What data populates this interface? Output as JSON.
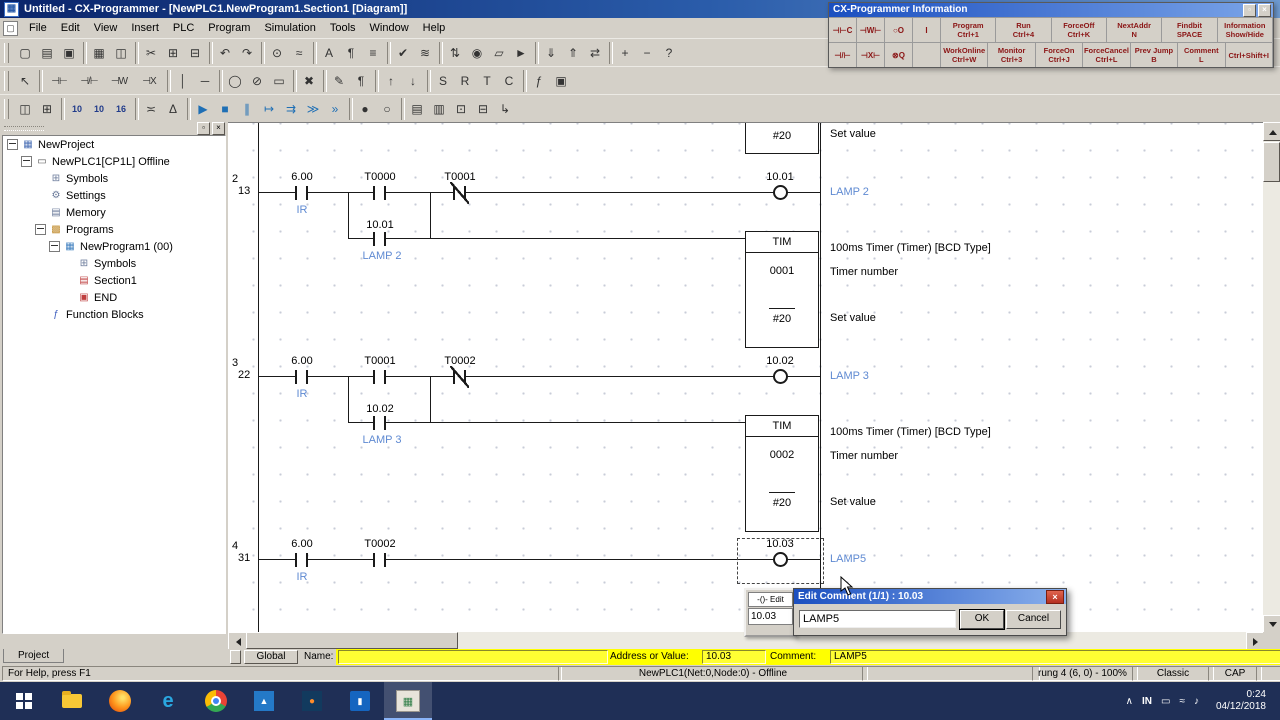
{
  "titlebar": {
    "title": "Untitled - CX-Programmer - [NewPLC1.NewProgram1.Section1 [Diagram]]"
  },
  "menubar": {
    "items": [
      "File",
      "Edit",
      "View",
      "Insert",
      "PLC",
      "Program",
      "Simulation",
      "Tools",
      "Window",
      "Help"
    ]
  },
  "icons": {
    "app": "▦",
    "doc": "▢",
    "close": "×",
    "dock": "▫",
    "project": "▦",
    "plc": "▭",
    "symbols": "⊞",
    "settings": "⚙",
    "memory": "▤",
    "programs": "▩",
    "program": "▦",
    "section": "▤",
    "end": "▣",
    "fb": "ƒ",
    "edge": "e",
    "photos": "▲",
    "media": "●",
    "bluestripe": "▮",
    "cx": "▦",
    "display": "▭",
    "network": "≈",
    "volume": "♪"
  },
  "toolbar1": {
    "icons": [
      {
        "n": "new-icon",
        "g": "▢"
      },
      {
        "n": "open-icon",
        "g": "▤"
      },
      {
        "n": "save-icon",
        "g": "▣"
      },
      {
        "n": "toolbar-separator",
        "c": "sep"
      },
      {
        "n": "print-icon",
        "g": "▦"
      },
      {
        "n": "print-preview-icon",
        "g": "◫"
      },
      {
        "n": "toolbar-separator",
        "c": "sep"
      },
      {
        "n": "cut-icon",
        "g": "✂"
      },
      {
        "n": "copy-icon",
        "g": "⊞"
      },
      {
        "n": "paste-icon",
        "g": "⊟"
      },
      {
        "n": "toolbar-separator",
        "c": "sep"
      },
      {
        "n": "undo-icon",
        "g": "↶"
      },
      {
        "n": "redo-icon",
        "g": "↷"
      },
      {
        "n": "toolbar-separator",
        "c": "sep"
      },
      {
        "n": "find-icon",
        "g": "⊙"
      },
      {
        "n": "replace-icon",
        "g": "≈"
      },
      {
        "n": "toolbar-separator",
        "c": "sep"
      },
      {
        "n": "symbol-table-icon",
        "g": "A"
      },
      {
        "n": "io-comment-icon",
        "g": "¶"
      },
      {
        "n": "section-list-icon",
        "g": "≡"
      },
      {
        "n": "toolbar-separator",
        "c": "sep"
      },
      {
        "n": "compile-icon",
        "g": "✔"
      },
      {
        "n": "compile-all-icon",
        "g": "≋"
      },
      {
        "n": "toolbar-separator",
        "c": "sep"
      },
      {
        "n": "work-online-icon",
        "g": "⇅"
      },
      {
        "n": "monitor-mode-icon",
        "g": "◉"
      },
      {
        "n": "program-mode-icon",
        "g": "▱"
      },
      {
        "n": "run-mode-icon",
        "g": "►"
      },
      {
        "n": "toolbar-separator",
        "c": "sep"
      },
      {
        "n": "transfer-to-plc-icon",
        "g": "⇓"
      },
      {
        "n": "transfer-from-plc-icon",
        "g": "⇑"
      },
      {
        "n": "compare-with-plc-icon",
        "g": "⇄"
      },
      {
        "n": "toolbar-separator",
        "c": "sep"
      },
      {
        "n": "zoom-in-icon",
        "g": "+"
      },
      {
        "n": "zoom-out-icon",
        "g": "−"
      },
      {
        "n": "help-icon",
        "g": "?"
      }
    ]
  },
  "toolbar2": {
    "icons": [
      {
        "n": "selection-arrow-icon",
        "g": "↖"
      },
      {
        "n": "toolbar-separator",
        "c": "sep"
      },
      {
        "n": "new-contact-icon",
        "g": "⊣⊢",
        "c": "wide"
      },
      {
        "n": "new-closed-contact-icon",
        "g": "⊣/⊢",
        "c": "wide"
      },
      {
        "n": "new-or-contact-icon",
        "g": "⊣W",
        "c": "wide"
      },
      {
        "n": "new-closed-or-contact-icon",
        "g": "⊣X",
        "c": "wide"
      },
      {
        "n": "toolbar-separator",
        "c": "sep"
      },
      {
        "n": "vertical-line-icon",
        "g": "│"
      },
      {
        "n": "horizontal-line-icon",
        "g": "─"
      },
      {
        "n": "toolbar-separator",
        "c": "sep"
      },
      {
        "n": "new-coil-icon",
        "g": "◯"
      },
      {
        "n": "new-closed-coil-icon",
        "g": "⊘"
      },
      {
        "n": "new-instruction-icon",
        "g": "▭"
      },
      {
        "n": "toolbar-separator",
        "c": "sep"
      },
      {
        "n": "delete-icon",
        "g": "✖"
      },
      {
        "n": "toolbar-separator",
        "c": "sep"
      },
      {
        "n": "edit-comment-icon",
        "g": "✎"
      },
      {
        "n": "rung-comment-icon",
        "g": "¶"
      },
      {
        "n": "toolbar-separator",
        "c": "sep"
      },
      {
        "n": "differential-up-icon",
        "g": "↑"
      },
      {
        "n": "differential-down-icon",
        "g": "↓"
      },
      {
        "n": "toolbar-separator",
        "c": "sep"
      },
      {
        "n": "set-instruction-icon",
        "g": "S"
      },
      {
        "n": "reset-instruction-icon",
        "g": "R"
      },
      {
        "n": "timer-instruction-icon",
        "g": "T"
      },
      {
        "n": "counter-instruction-icon",
        "g": "C"
      },
      {
        "n": "toolbar-separator",
        "c": "sep"
      },
      {
        "n": "function-block-icon",
        "g": "ƒ"
      },
      {
        "n": "block-program-icon",
        "g": "▣"
      }
    ]
  },
  "toolbar3": {
    "icons": [
      {
        "n": "cascade-windows-icon",
        "g": "◫"
      },
      {
        "n": "tile-windows-icon",
        "g": "⊞"
      },
      {
        "n": "toolbar-separator",
        "c": "sep"
      },
      {
        "n": "address-format-icon",
        "g": "10",
        "c": "txt"
      },
      {
        "n": "decimal-format-icon",
        "g": "10",
        "c": "txt"
      },
      {
        "n": "hex-format-icon",
        "g": "16",
        "c": "txt"
      },
      {
        "n": "toolbar-separator",
        "c": "sep"
      },
      {
        "n": "watch-window-icon",
        "g": "≍"
      },
      {
        "n": "differential-monitor-icon",
        "g": "Δ"
      },
      {
        "n": "toolbar-separator",
        "c": "sep"
      },
      {
        "n": "run-simulation-icon",
        "g": "▶",
        "c": "sim"
      },
      {
        "n": "stop-simulation-icon",
        "g": "■",
        "c": "sim"
      },
      {
        "n": "pause-simulation-icon",
        "g": "∥",
        "c": "sim"
      },
      {
        "n": "step-run-icon",
        "g": "↦",
        "c": "sim"
      },
      {
        "n": "step-over-icon",
        "g": "⇉",
        "c": "sim"
      },
      {
        "n": "continuous-step-run-icon",
        "g": "≫",
        "c": "sim"
      },
      {
        "n": "scan-run-icon",
        "g": "»",
        "c": "sim"
      },
      {
        "n": "toolbar-separator",
        "c": "sep"
      },
      {
        "n": "set-breakpoint-icon",
        "g": "●"
      },
      {
        "n": "clear-breakpoints-icon",
        "g": "○"
      },
      {
        "n": "toolbar-separator",
        "c": "sep"
      },
      {
        "n": "show-rung-comments-icon",
        "g": "▤"
      },
      {
        "n": "show-annotations-icon",
        "g": "▥"
      },
      {
        "n": "grid-toggle-icon",
        "g": "⊡"
      },
      {
        "n": "monitor-hex-icon",
        "g": "⊟"
      },
      {
        "n": "wrap-rungs-icon",
        "g": "↳"
      }
    ]
  },
  "tree": {
    "root": "NewProject",
    "plc": "NewPLC1[CP1L] Offline",
    "symbols1": "Symbols",
    "settings": "Settings",
    "memory": "Memory",
    "programs": "Programs",
    "program": "NewProgram1 (00)",
    "symbols2": "Symbols",
    "section": "Section1",
    "end": "END",
    "fb": "Function Blocks",
    "tab": "Project"
  },
  "ladder": {
    "top": {
      "sv": "#20",
      "cmt": "Set value"
    },
    "rung2": {
      "num": "2",
      "step": "13",
      "c1": "6.00",
      "c1_cmt": "IR",
      "c2": "T0000",
      "c3": "T0001",
      "coil": "10.01",
      "coil_cmt": "LAMP 2",
      "br": "10.01",
      "br_cmt": "LAMP 2",
      "tim": "TIM",
      "tim_cmt": "100ms Timer (Timer) [BCD Type]",
      "tim_no": "0001",
      "tim_no_cmt": "Timer number",
      "sv": "#20",
      "sv_cmt": "Set value"
    },
    "rung3": {
      "num": "3",
      "step": "22",
      "c1": "6.00",
      "c1_cmt": "IR",
      "c2": "T0001",
      "c3": "T0002",
      "coil": "10.02",
      "coil_cmt": "LAMP 3",
      "br": "10.02",
      "br_cmt": "LAMP 3",
      "tim": "TIM",
      "tim_cmt": "100ms Timer (Timer) [BCD Type]",
      "tim_no": "0002",
      "tim_no_cmt": "Timer number",
      "sv": "#20",
      "sv_cmt": "Set value"
    },
    "rung4": {
      "num": "4",
      "step": "31",
      "c1": "6.00",
      "c1_cmt": "IR",
      "c2": "T0002",
      "coil": "10.03",
      "coil_cmt": "LAMP5"
    }
  },
  "info_window": {
    "title": "CX-Programmer Information",
    "row1_syms": [
      "⊣⊢C",
      "⊣W⊢",
      "○O",
      "I"
    ],
    "row2_syms": [
      "⊣/⊢",
      "⊣X⊢",
      "⊗Q",
      ""
    ],
    "row1": [
      {
        "t": "Program",
        "b": "Ctrl+1"
      },
      {
        "t": "Run",
        "b": "Ctrl+4"
      },
      {
        "t": "ForceOff",
        "b": "Ctrl+K"
      },
      {
        "t": "NextAddr",
        "b": "N"
      },
      {
        "t": "Findbit",
        "b": "SPACE"
      },
      {
        "t": "Information",
        "b": "Show/Hide"
      }
    ],
    "row2": [
      {
        "t": "WorkOnline",
        "b": "Ctrl+W"
      },
      {
        "t": "Monitor",
        "b": "Ctrl+3"
      },
      {
        "t": "ForceOn",
        "b": "Ctrl+J"
      },
      {
        "t": "ForceCancel",
        "b": "Ctrl+L"
      },
      {
        "t": "Prev Jump",
        "b": "B"
      },
      {
        "t": "Comment",
        "b": "L"
      },
      {
        "t": "",
        "b": "Ctrl+Shift+I"
      }
    ]
  },
  "edit_mini": {
    "label": "-()- Edit",
    "value": "10.03"
  },
  "edit_dialog": {
    "title": "Edit Comment (1/1) : 10.03",
    "value": "LAMP5",
    "ok": "OK",
    "cancel": "Cancel"
  },
  "watchbar": {
    "global": "Global",
    "name_label": "Name:",
    "name_value": "",
    "addr_label": "Address or Value:",
    "addr_value": "10.03",
    "cmt_label": "Comment:",
    "cmt_value": "LAMP5"
  },
  "statusbar": {
    "help": "For Help, press F1",
    "plc": "NewPLC1(Net:0,Node:0) - Offline",
    "rung": "rung 4 (6, 0) - 100%",
    "style": "Classic",
    "caps": "CAP"
  },
  "taskbar": {
    "expand": "∧",
    "lang": "IN",
    "time": "0:24",
    "date": "04/12/2018"
  }
}
